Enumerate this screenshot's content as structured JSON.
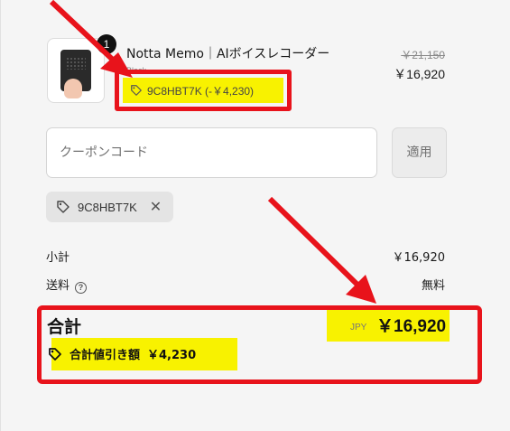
{
  "product": {
    "title": "Notta Memo｜AIボイスレコーダー",
    "variant": "Black",
    "quantity": "1",
    "original_price": "￥21,150",
    "sale_price": "￥16,920",
    "discount_label": "9C8HBT7K (-￥4,230)"
  },
  "coupon": {
    "placeholder": "クーポンコード",
    "apply_label": "適用",
    "applied_code": "9C8HBT7K"
  },
  "summary": {
    "subtotal_label": "小計",
    "subtotal_value": "￥16,920",
    "shipping_label": "送料",
    "shipping_value": "無料",
    "total_label": "合計",
    "currency": "JPY",
    "total_value": "￥16,920",
    "savings_label": "合計値引き額",
    "savings_value": "￥4,230"
  },
  "colors": {
    "highlight": "#f8f200",
    "annotation": "#e8131b"
  }
}
